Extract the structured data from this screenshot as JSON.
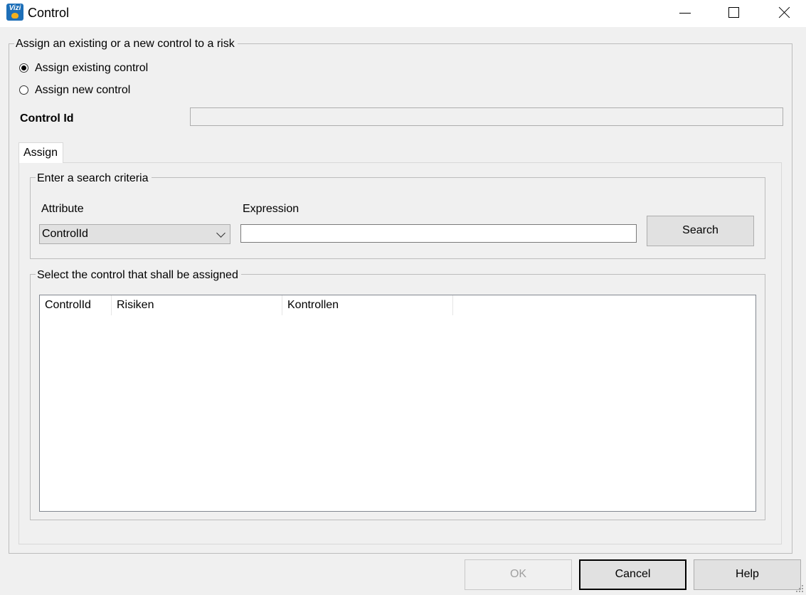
{
  "window": {
    "title": "Control",
    "icon": "vizi-app-icon",
    "icon_text": "Vizi"
  },
  "assign_group": {
    "legend": "Assign an existing or a new control to a risk",
    "options": [
      {
        "label": "Assign existing control",
        "checked": true
      },
      {
        "label": "Assign new control",
        "checked": false
      }
    ],
    "control_id_label": "Control Id",
    "control_id_value": ""
  },
  "tabs": [
    {
      "label": "Assign",
      "active": true
    }
  ],
  "search": {
    "legend": "Enter a search criteria",
    "attribute_label": "Attribute",
    "attribute_value": "ControlId",
    "expression_label": "Expression",
    "expression_value": "",
    "search_button": "Search"
  },
  "results": {
    "legend": "Select the control that shall be assigned",
    "columns": [
      "ControlId",
      "Risiken",
      "Kontrollen"
    ],
    "rows": []
  },
  "footer": {
    "ok": "OK",
    "cancel": "Cancel",
    "help": "Help"
  }
}
